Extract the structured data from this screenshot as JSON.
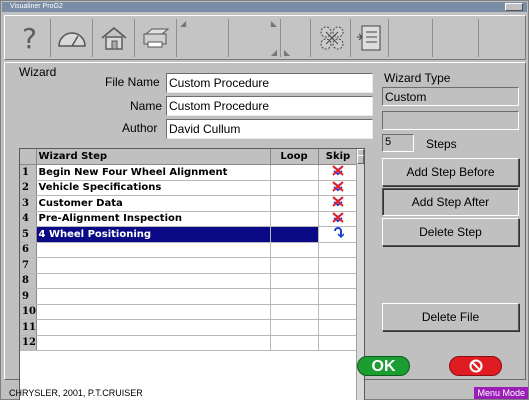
{
  "window": {
    "title": "Visualiner ProG2"
  },
  "toolbar": {
    "buttons": [
      {
        "icon": "help-icon",
        "label": "?"
      },
      {
        "icon": "speedometer-icon"
      },
      {
        "icon": "home-icon"
      },
      {
        "icon": "printer-icon"
      },
      {
        "icon": "blank"
      },
      {
        "icon": "blank"
      },
      {
        "icon": "blank"
      },
      {
        "icon": "wheels-icon"
      },
      {
        "icon": "procedure-icon"
      }
    ]
  },
  "wizard": {
    "group_label": "Wizard",
    "file_name_label": "File Name",
    "file_name_value": "Custom Procedure",
    "name_label": "Name",
    "name_value": "Custom Procedure",
    "author_label": "Author",
    "author_value": "David Cullum"
  },
  "wizard_type": {
    "label": "Wizard Type",
    "value": "Custom",
    "extra_value": "",
    "steps_count": "5",
    "steps_label": "Steps"
  },
  "grid": {
    "columns": [
      "Wizard Step",
      "Loop",
      "Skip"
    ],
    "rows": [
      {
        "num": "1",
        "step": "Begin New Four Wheel Alignment",
        "loop": "",
        "skip": "no-skip"
      },
      {
        "num": "2",
        "step": "Vehicle Specifications",
        "loop": "",
        "skip": "no-skip"
      },
      {
        "num": "3",
        "step": "Customer Data",
        "loop": "",
        "skip": "no-skip"
      },
      {
        "num": "4",
        "step": "Pre-Alignment Inspection",
        "loop": "",
        "skip": "no-skip"
      },
      {
        "num": "5",
        "step": "4 Wheel Positioning",
        "loop": "",
        "skip": "skip-arrow",
        "selected": true
      },
      {
        "num": "6",
        "step": "",
        "loop": "",
        "skip": ""
      },
      {
        "num": "7",
        "step": "",
        "loop": "",
        "skip": ""
      },
      {
        "num": "8",
        "step": "",
        "loop": "",
        "skip": ""
      },
      {
        "num": "9",
        "step": "",
        "loop": "",
        "skip": ""
      },
      {
        "num": "10",
        "step": "",
        "loop": "",
        "skip": ""
      },
      {
        "num": "11",
        "step": "",
        "loop": "",
        "skip": ""
      },
      {
        "num": "12",
        "step": "",
        "loop": "",
        "skip": ""
      }
    ]
  },
  "actions": {
    "add_before": "Add Step Before",
    "add_after": "Add Step After",
    "delete_step": "Delete Step",
    "delete_file": "Delete File",
    "ok": "OK"
  },
  "status": {
    "vehicle": "CHRYSLER, 2001, P.T.CRUISER",
    "mode": "Menu Mode"
  },
  "colors": {
    "selection": "#0a0a86",
    "ok": "#1c9d32",
    "cancel": "#e01c23",
    "mode": "#9a1fb7"
  }
}
